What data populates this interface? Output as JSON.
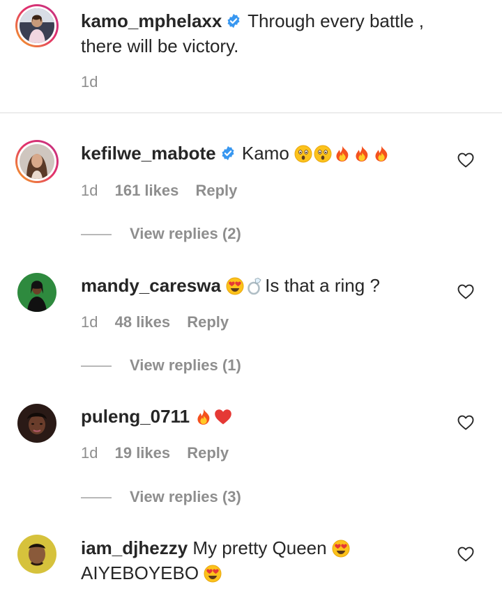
{
  "caption": {
    "username": "kamo_mphelaxx",
    "text": "Through every battle , there will be victory.",
    "time": "1d"
  },
  "comments": [
    {
      "username": "kefilwe_mabote",
      "text": "Kamo",
      "emojis": [
        "astonished-face",
        "astonished-face",
        "fire",
        "fire",
        "fire"
      ],
      "time": "1d",
      "likes": "161 likes",
      "reply": "Reply",
      "view_replies": "View replies (2)"
    },
    {
      "username": "mandy_careswa",
      "text": "Is that a ring ?",
      "emojis": [
        "smiling-face-with-heart-eyes",
        "ring"
      ],
      "time": "1d",
      "likes": "48 likes",
      "reply": "Reply",
      "view_replies": "View replies (1)"
    },
    {
      "username": "puleng_0711",
      "text": "",
      "emojis": [
        "fire",
        "red-heart"
      ],
      "time": "1d",
      "likes": "19 likes",
      "reply": "Reply",
      "view_replies": "View replies (3)"
    },
    {
      "username": "iam_djhezzy",
      "text": "My pretty Queen",
      "text2": "AIYEBOYEBO",
      "emojis": [
        "smiling-face-with-heart-eyes",
        "smiling-face-with-heart-eyes"
      ]
    }
  ],
  "colors": {
    "verified": "#3897f0",
    "meta": "#8e8e8e",
    "text": "#262626",
    "story_ring_start": "#f5a623",
    "story_ring_end": "#c13584"
  },
  "icons": {
    "verified": "verified-badge-icon",
    "like": "heart-outline-icon"
  }
}
